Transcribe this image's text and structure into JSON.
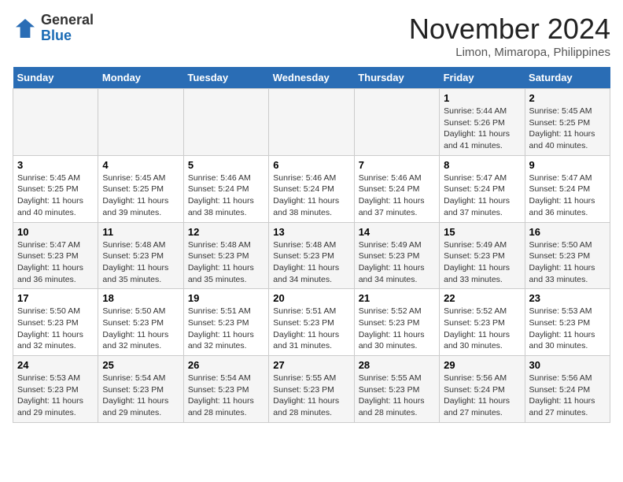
{
  "header": {
    "logo_general": "General",
    "logo_blue": "Blue",
    "month_title": "November 2024",
    "location": "Limon, Mimaropa, Philippines"
  },
  "weekdays": [
    "Sunday",
    "Monday",
    "Tuesday",
    "Wednesday",
    "Thursday",
    "Friday",
    "Saturday"
  ],
  "weeks": [
    [
      {
        "day": "",
        "info": ""
      },
      {
        "day": "",
        "info": ""
      },
      {
        "day": "",
        "info": ""
      },
      {
        "day": "",
        "info": ""
      },
      {
        "day": "",
        "info": ""
      },
      {
        "day": "1",
        "info": "Sunrise: 5:44 AM\nSunset: 5:26 PM\nDaylight: 11 hours\nand 41 minutes."
      },
      {
        "day": "2",
        "info": "Sunrise: 5:45 AM\nSunset: 5:25 PM\nDaylight: 11 hours\nand 40 minutes."
      }
    ],
    [
      {
        "day": "3",
        "info": "Sunrise: 5:45 AM\nSunset: 5:25 PM\nDaylight: 11 hours\nand 40 minutes."
      },
      {
        "day": "4",
        "info": "Sunrise: 5:45 AM\nSunset: 5:25 PM\nDaylight: 11 hours\nand 39 minutes."
      },
      {
        "day": "5",
        "info": "Sunrise: 5:46 AM\nSunset: 5:24 PM\nDaylight: 11 hours\nand 38 minutes."
      },
      {
        "day": "6",
        "info": "Sunrise: 5:46 AM\nSunset: 5:24 PM\nDaylight: 11 hours\nand 38 minutes."
      },
      {
        "day": "7",
        "info": "Sunrise: 5:46 AM\nSunset: 5:24 PM\nDaylight: 11 hours\nand 37 minutes."
      },
      {
        "day": "8",
        "info": "Sunrise: 5:47 AM\nSunset: 5:24 PM\nDaylight: 11 hours\nand 37 minutes."
      },
      {
        "day": "9",
        "info": "Sunrise: 5:47 AM\nSunset: 5:24 PM\nDaylight: 11 hours\nand 36 minutes."
      }
    ],
    [
      {
        "day": "10",
        "info": "Sunrise: 5:47 AM\nSunset: 5:23 PM\nDaylight: 11 hours\nand 36 minutes."
      },
      {
        "day": "11",
        "info": "Sunrise: 5:48 AM\nSunset: 5:23 PM\nDaylight: 11 hours\nand 35 minutes."
      },
      {
        "day": "12",
        "info": "Sunrise: 5:48 AM\nSunset: 5:23 PM\nDaylight: 11 hours\nand 35 minutes."
      },
      {
        "day": "13",
        "info": "Sunrise: 5:48 AM\nSunset: 5:23 PM\nDaylight: 11 hours\nand 34 minutes."
      },
      {
        "day": "14",
        "info": "Sunrise: 5:49 AM\nSunset: 5:23 PM\nDaylight: 11 hours\nand 34 minutes."
      },
      {
        "day": "15",
        "info": "Sunrise: 5:49 AM\nSunset: 5:23 PM\nDaylight: 11 hours\nand 33 minutes."
      },
      {
        "day": "16",
        "info": "Sunrise: 5:50 AM\nSunset: 5:23 PM\nDaylight: 11 hours\nand 33 minutes."
      }
    ],
    [
      {
        "day": "17",
        "info": "Sunrise: 5:50 AM\nSunset: 5:23 PM\nDaylight: 11 hours\nand 32 minutes."
      },
      {
        "day": "18",
        "info": "Sunrise: 5:50 AM\nSunset: 5:23 PM\nDaylight: 11 hours\nand 32 minutes."
      },
      {
        "day": "19",
        "info": "Sunrise: 5:51 AM\nSunset: 5:23 PM\nDaylight: 11 hours\nand 32 minutes."
      },
      {
        "day": "20",
        "info": "Sunrise: 5:51 AM\nSunset: 5:23 PM\nDaylight: 11 hours\nand 31 minutes."
      },
      {
        "day": "21",
        "info": "Sunrise: 5:52 AM\nSunset: 5:23 PM\nDaylight: 11 hours\nand 30 minutes."
      },
      {
        "day": "22",
        "info": "Sunrise: 5:52 AM\nSunset: 5:23 PM\nDaylight: 11 hours\nand 30 minutes."
      },
      {
        "day": "23",
        "info": "Sunrise: 5:53 AM\nSunset: 5:23 PM\nDaylight: 11 hours\nand 30 minutes."
      }
    ],
    [
      {
        "day": "24",
        "info": "Sunrise: 5:53 AM\nSunset: 5:23 PM\nDaylight: 11 hours\nand 29 minutes."
      },
      {
        "day": "25",
        "info": "Sunrise: 5:54 AM\nSunset: 5:23 PM\nDaylight: 11 hours\nand 29 minutes."
      },
      {
        "day": "26",
        "info": "Sunrise: 5:54 AM\nSunset: 5:23 PM\nDaylight: 11 hours\nand 28 minutes."
      },
      {
        "day": "27",
        "info": "Sunrise: 5:55 AM\nSunset: 5:23 PM\nDaylight: 11 hours\nand 28 minutes."
      },
      {
        "day": "28",
        "info": "Sunrise: 5:55 AM\nSunset: 5:23 PM\nDaylight: 11 hours\nand 28 minutes."
      },
      {
        "day": "29",
        "info": "Sunrise: 5:56 AM\nSunset: 5:24 PM\nDaylight: 11 hours\nand 27 minutes."
      },
      {
        "day": "30",
        "info": "Sunrise: 5:56 AM\nSunset: 5:24 PM\nDaylight: 11 hours\nand 27 minutes."
      }
    ]
  ]
}
